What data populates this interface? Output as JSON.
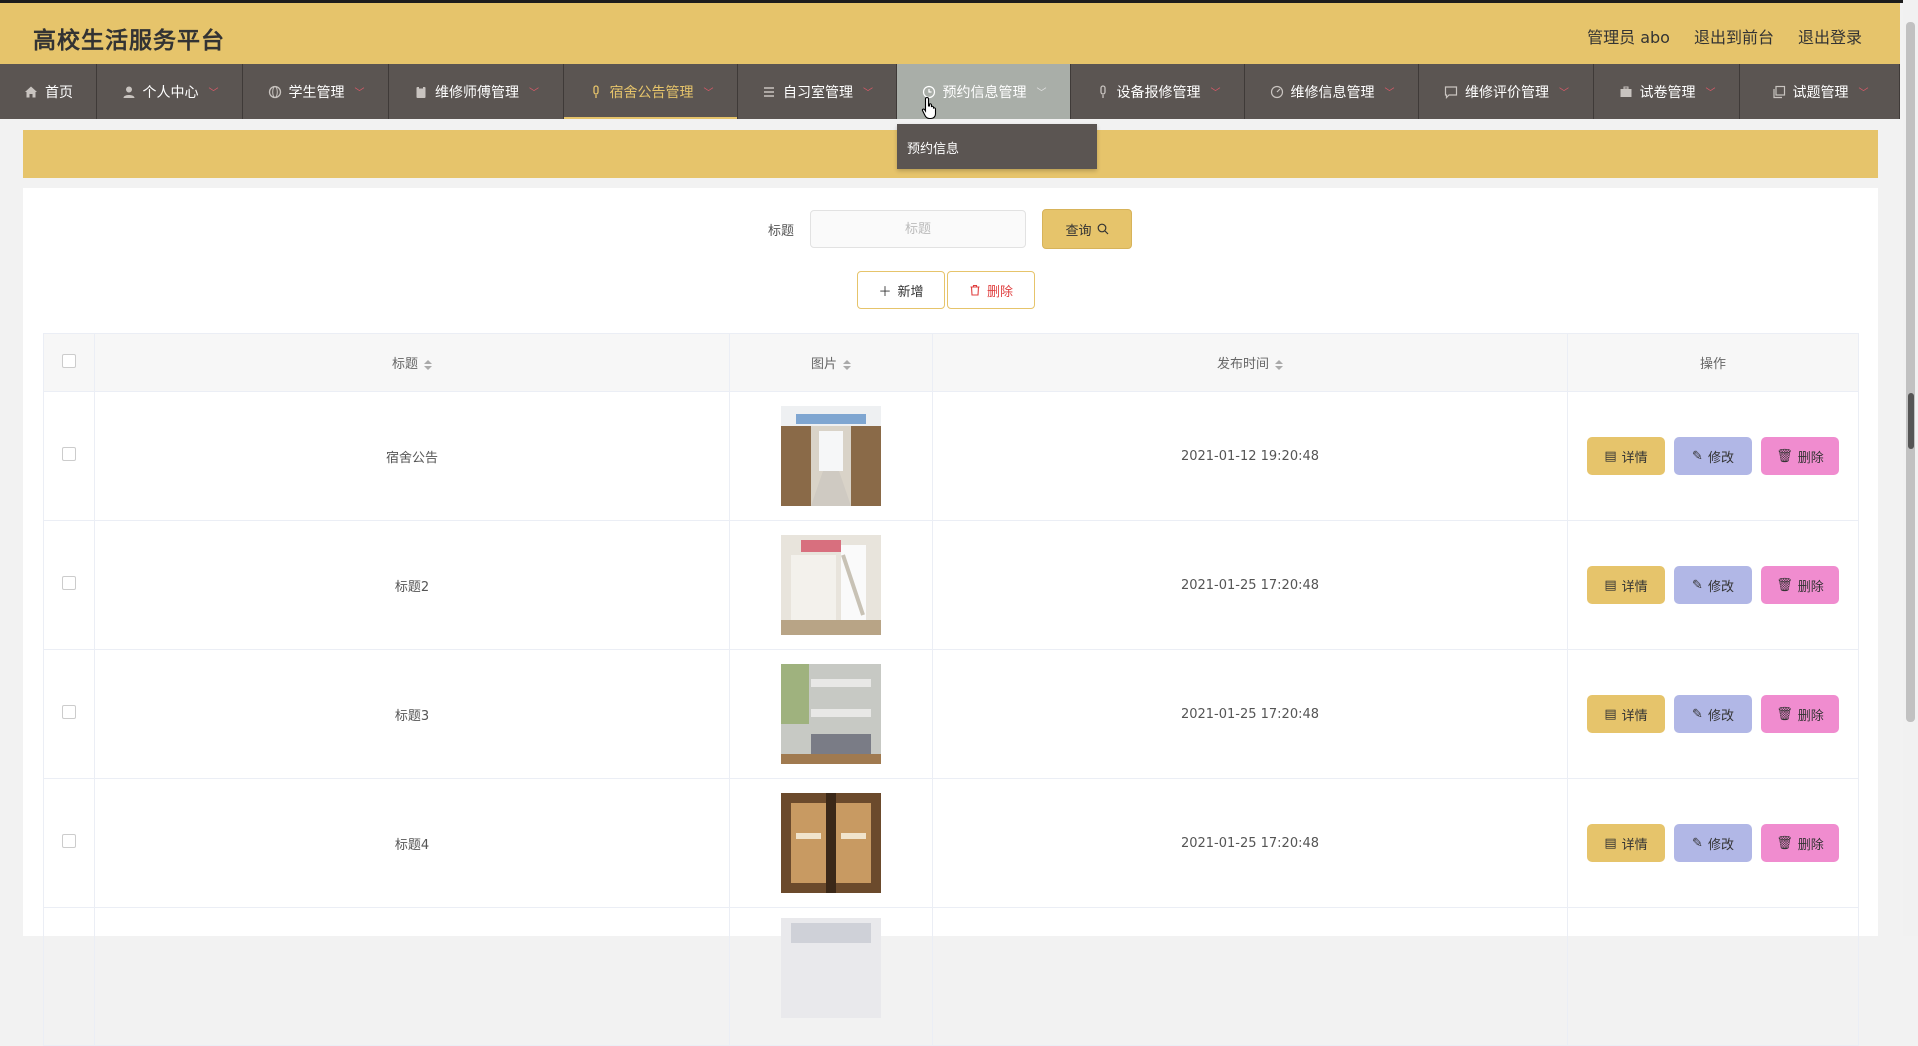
{
  "app": {
    "title": "高校生活服务平台"
  },
  "header": {
    "user": "管理员 abo",
    "to_front": "退出到前台",
    "logout": "退出登录"
  },
  "nav": {
    "items": [
      {
        "label": "首页",
        "icon": "home-icon"
      },
      {
        "label": "个人中心",
        "icon": "user-icon"
      },
      {
        "label": "学生管理",
        "icon": "globe-icon"
      },
      {
        "label": "维修师傅管理",
        "icon": "clipboard-icon"
      },
      {
        "label": "宿舍公告管理",
        "icon": "mic-icon"
      },
      {
        "label": "自习室管理",
        "icon": "menu-icon"
      },
      {
        "label": "预约信息管理",
        "icon": "clock-icon"
      },
      {
        "label": "设备报修管理",
        "icon": "mic-icon"
      },
      {
        "label": "维修信息管理",
        "icon": "gauge-icon"
      },
      {
        "label": "维修评价管理",
        "icon": "chat-icon"
      },
      {
        "label": "试卷管理",
        "icon": "briefcase-icon"
      },
      {
        "label": "试题管理",
        "icon": "copy-icon"
      }
    ],
    "dropdown_item": "预约信息"
  },
  "search": {
    "label": "标题",
    "placeholder": "标题",
    "query_label": "查询"
  },
  "toolbar": {
    "add_label": "新增",
    "delete_label": "删除"
  },
  "table": {
    "columns": [
      "标题",
      "图片",
      "发布时间",
      "操作"
    ],
    "rows": [
      {
        "title": "宿舍公告",
        "time": "2021-01-12 19:20:48"
      },
      {
        "title": "标题2",
        "time": "2021-01-25 17:20:48"
      },
      {
        "title": "标题3",
        "time": "2021-01-25 17:20:48"
      },
      {
        "title": "标题4",
        "time": "2021-01-25 17:20:48"
      }
    ],
    "ops": {
      "detail": "详情",
      "edit": "修改",
      "remove": "删除"
    }
  },
  "colors": {
    "accent": "#e6c46b",
    "nav": "#5b5552",
    "edit": "#b1b7e6",
    "remove": "#f08ccf"
  }
}
